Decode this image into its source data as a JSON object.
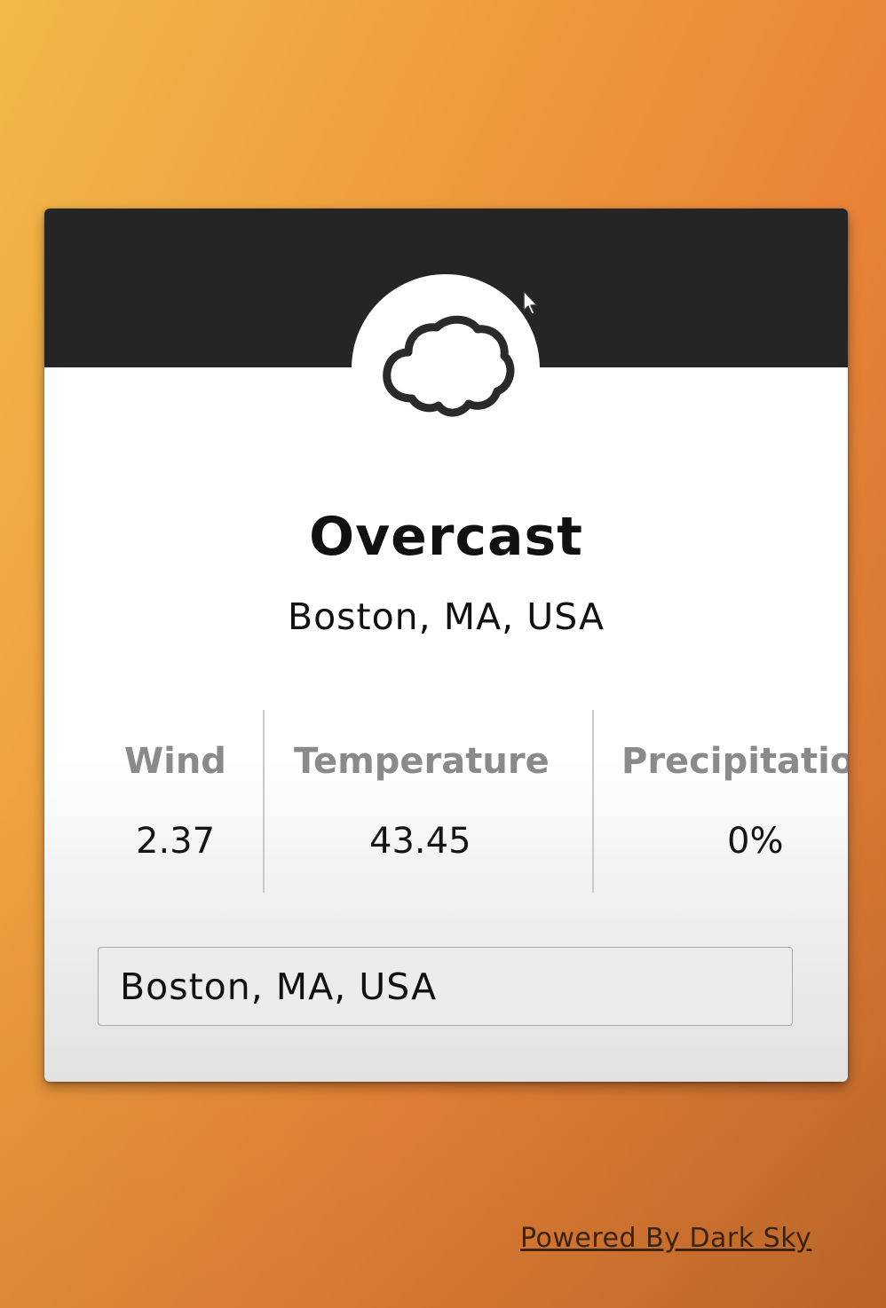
{
  "weather": {
    "summary": "Overcast",
    "location": "Boston, MA, USA",
    "icon": "cloud-icon"
  },
  "stats": {
    "wind_label": "Wind",
    "wind_value": "2.37",
    "temperature_label": "Temperature",
    "temperature_value": "43.45",
    "precipitation_label": "Precipitation",
    "precipitation_value": "0%"
  },
  "search": {
    "value": "Boston, MA, USA"
  },
  "footer": {
    "link_text": "Powered By Dark Sky"
  },
  "colors": {
    "header": "#252525",
    "background_start": "#f3b84a",
    "background_end": "#c66d2e",
    "label": "#8a8a8a"
  }
}
